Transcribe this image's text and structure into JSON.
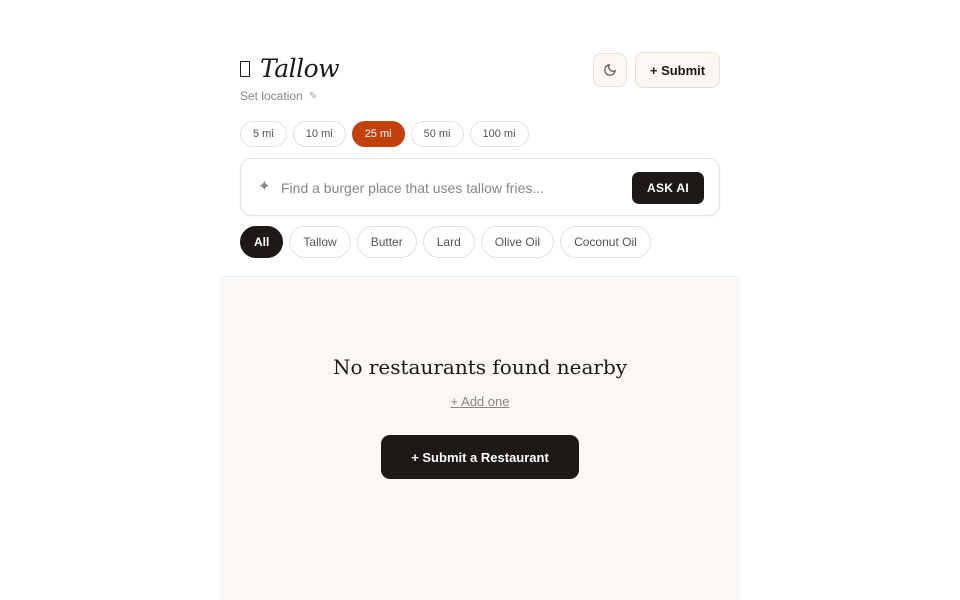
{
  "app": {
    "title": "Tallow",
    "logo_icon": "tallow-drop-icon",
    "location_label": "Set location",
    "location_icon": "✎"
  },
  "header": {
    "theme_icon": "moon-icon",
    "submit_label": "+ Submit"
  },
  "distance": {
    "options": [
      "5 mi",
      "10 mi",
      "25 mi",
      "50 mi",
      "100 mi"
    ],
    "selected": "25 mi"
  },
  "search": {
    "icon": "✦",
    "placeholder": "Find a burger place that uses tallow fries...",
    "value": "",
    "ask_label": "ASK AI"
  },
  "filters": {
    "options": [
      "All",
      "Tallow",
      "Butter",
      "Lard",
      "Olive Oil",
      "Coconut Oil"
    ],
    "selected": "All"
  },
  "empty_state": {
    "title": "No restaurants found nearby",
    "add_link": "+ Add one",
    "submit_button": "+ Submit a Restaurant"
  },
  "colors": {
    "accent": "#c2410c",
    "dark": "#1c1917",
    "content_bg": "#faf7f4",
    "button_bg": "#fbf7f2"
  }
}
